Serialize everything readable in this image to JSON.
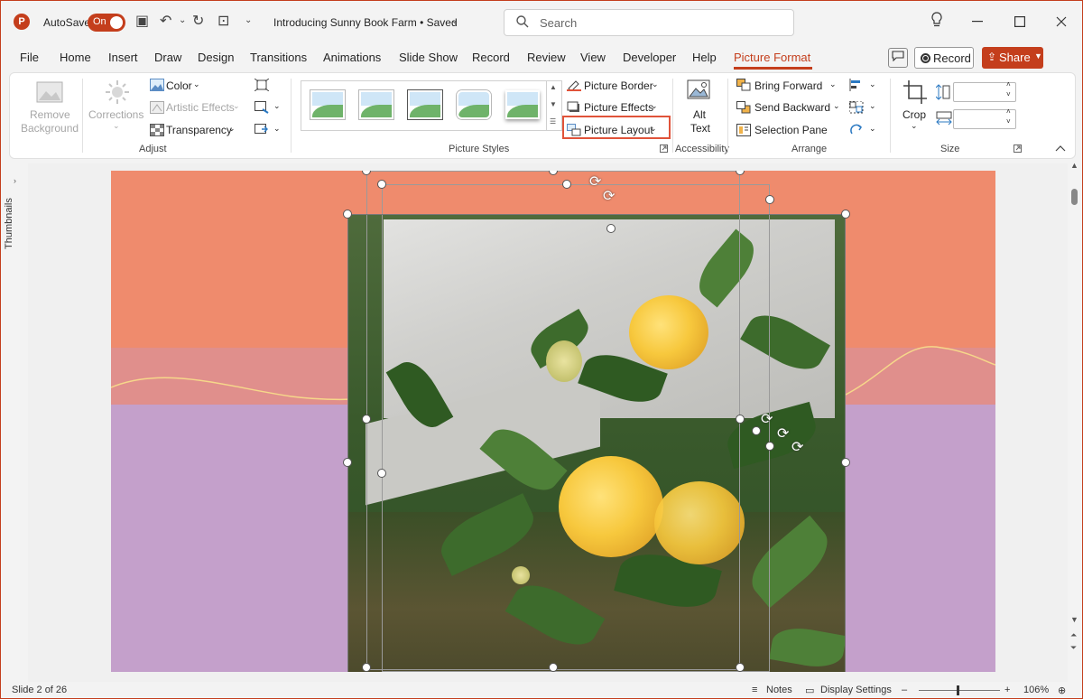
{
  "titlebar": {
    "app_letter": "P",
    "autosave_label": "AutoSave",
    "autosave_state": "On",
    "doc_title": "Introducing Sunny Book Farm • Saved",
    "title_caret": "⌄",
    "search_placeholder": "Search",
    "icons": {
      "save": "▣",
      "undo": "↶",
      "undo_caret": "⌄",
      "redo": "↻",
      "present": "⊡",
      "customize": "⌄"
    }
  },
  "tabs": [
    "File",
    "Home",
    "Insert",
    "Draw",
    "Design",
    "Transitions",
    "Animations",
    "Slide Show",
    "Record",
    "Review",
    "View",
    "Developer",
    "Help",
    "Picture Format"
  ],
  "active_tab": "Picture Format",
  "header_actions": {
    "comment": "💬",
    "record": "Record",
    "share": "Share"
  },
  "accent_color": "#c43e1c",
  "ribbon": {
    "adjust": {
      "label": "Adjust",
      "remove_background": [
        "Remove",
        "Background"
      ],
      "corrections": "Corrections",
      "color": "Color",
      "artistic_effects": "Artistic Effects",
      "transparency": "Transparency"
    },
    "picture_styles": {
      "label": "Picture Styles",
      "picture_border": "Picture Border",
      "picture_effects": "Picture Effects",
      "picture_layout": "Picture Layout"
    },
    "accessibility": {
      "label": "Accessibility",
      "alt_text": [
        "Alt",
        "Text"
      ]
    },
    "arrange": {
      "label": "Arrange",
      "bring_forward": "Bring Forward",
      "send_backward": "Send Backward",
      "selection_pane": "Selection Pane"
    },
    "size": {
      "label": "Size",
      "crop": "Crop"
    }
  },
  "sidebar": {
    "label": "Thumbnails",
    "toggle": "›"
  },
  "statusbar": {
    "slide_info": "Slide 2 of 26",
    "notes": "Notes",
    "display_settings": "Display Settings",
    "zoom_out": "–",
    "zoom_in": "+",
    "zoom": "106%"
  }
}
